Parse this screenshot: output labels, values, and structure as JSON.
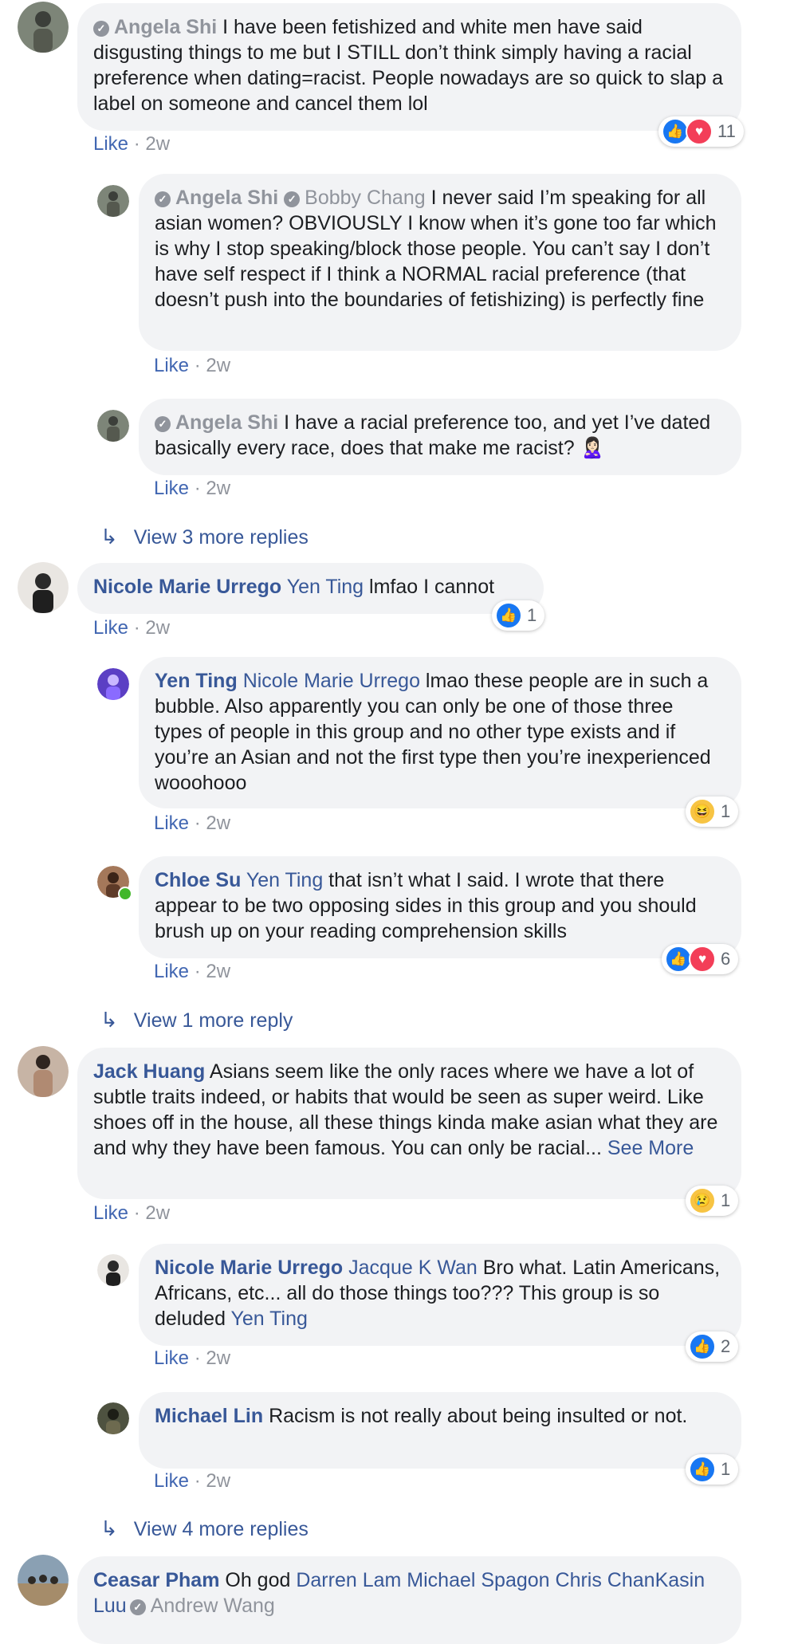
{
  "comments": {
    "c1": {
      "author": "Angela Shi",
      "text": " I have been fetishized and white men have said disgusting things to me but I STILL don’t think simply having a racial preference when dating=racist. People nowadays are so quick to slap a label on someone and cancel them lol",
      "like": "Like",
      "time": "2w",
      "reaction_count": "11"
    },
    "r1": {
      "author": "Angela Shi",
      "mention": "Bobby Chang",
      "text": " I never said I’m speaking for all asian women? OBVIOUSLY I know when it’s gone too far which is why I stop speaking/block those people. You can’t say I don’t have self respect if I think a NORMAL racial preference (that doesn’t push into the boundaries of fetishizing) is perfectly fine",
      "like": "Like",
      "time": "2w"
    },
    "r2": {
      "author": "Angela Shi",
      "text": " I have a racial preference too, and yet I’ve dated basically every race, does that make me racist? 🙎🏻‍♀️",
      "like": "Like",
      "time": "2w"
    },
    "more1": "View 3 more replies",
    "c2": {
      "author": "Nicole Marie Urrego",
      "mention": "Yen Ting",
      "text": " lmfao I cannot",
      "like": "Like",
      "time": "2w",
      "reaction_count": "1"
    },
    "r3": {
      "author": "Yen Ting",
      "mention": "Nicole Marie Urrego",
      "text": " lmao these people are in such a bubble. Also apparently you can only be one of those three types of people in this group and no other type exists and if you’re an Asian and not the first type then you’re inexperienced wooohooo",
      "like": "Like",
      "time": "2w",
      "reaction_count": "1"
    },
    "r4": {
      "author": "Chloe Su",
      "mention": "Yen Ting",
      "text": " that isn’t what I said. I wrote that there appear to be two opposing sides in this group and you should brush up on your reading comprehension skills",
      "like": "Like",
      "time": "2w",
      "reaction_count": "6"
    },
    "more2": "View 1 more reply",
    "c3": {
      "author": "Jack Huang",
      "text": " Asians seem like the only races where we have a lot of subtle traits indeed, or habits that would be seen as super weird. Like shoes off in the house, all these things kinda make asian what they are and why they have been famous. You can only be racial...",
      "see_more": " See More",
      "like": "Like",
      "time": "2w",
      "reaction_count": "1"
    },
    "r5": {
      "author": "Nicole Marie Urrego",
      "mention": "Jacque K Wan",
      "text": " Bro what. Latin Americans, Africans, etc... all do those things too??? This group is so deluded ",
      "mention2": "Yen Ting",
      "like": "Like",
      "time": "2w",
      "reaction_count": "2"
    },
    "r6": {
      "author": "Michael Lin",
      "text": " Racism is not really about being insulted or not.",
      "like": "Like",
      "time": "2w",
      "reaction_count": "1"
    },
    "more3": "View 4 more replies",
    "c4": {
      "author": "Ceasar Pham",
      "text": " Oh god ",
      "mention": "Darren Lam Michael Spagon Chris ChanKasin Luu",
      "mention2": "Andrew Wang"
    }
  },
  "icons": {
    "arrow": "reply-arrow-icon",
    "verified": "verified-badge-icon",
    "like": "like-reaction-icon",
    "love": "love-reaction-icon",
    "haha": "haha-reaction-icon",
    "sad": "sad-reaction-icon"
  },
  "colors": {
    "link": "#385898",
    "bubble": "#f2f3f5",
    "meta": "#90949c",
    "like_blue": "#1877f2",
    "love_red": "#f33e58"
  }
}
